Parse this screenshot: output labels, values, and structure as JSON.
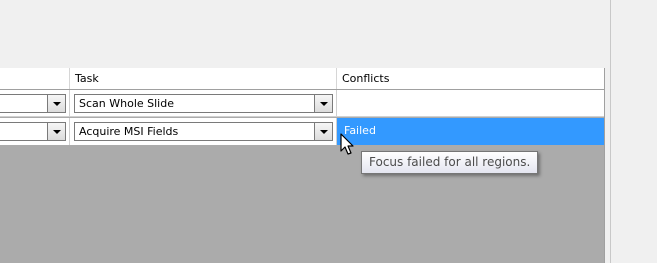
{
  "grid": {
    "columns": [
      {
        "label": ""
      },
      {
        "label": "Task"
      },
      {
        "label": "Conflicts"
      }
    ],
    "rows": [
      {
        "task": "Scan Whole Slide",
        "conflicts": "",
        "selected": false
      },
      {
        "task": "Acquire MSI Fields",
        "conflicts": "Failed",
        "selected": true
      }
    ]
  },
  "tooltip": {
    "text": "Focus failed for all regions."
  },
  "icons": {
    "dropdown": "chevron-down-icon",
    "cursor": "arrow-cursor-icon"
  },
  "colors": {
    "selection": "#3399ff",
    "grid_background": "#ababab",
    "tooltip_border": "#767676"
  }
}
